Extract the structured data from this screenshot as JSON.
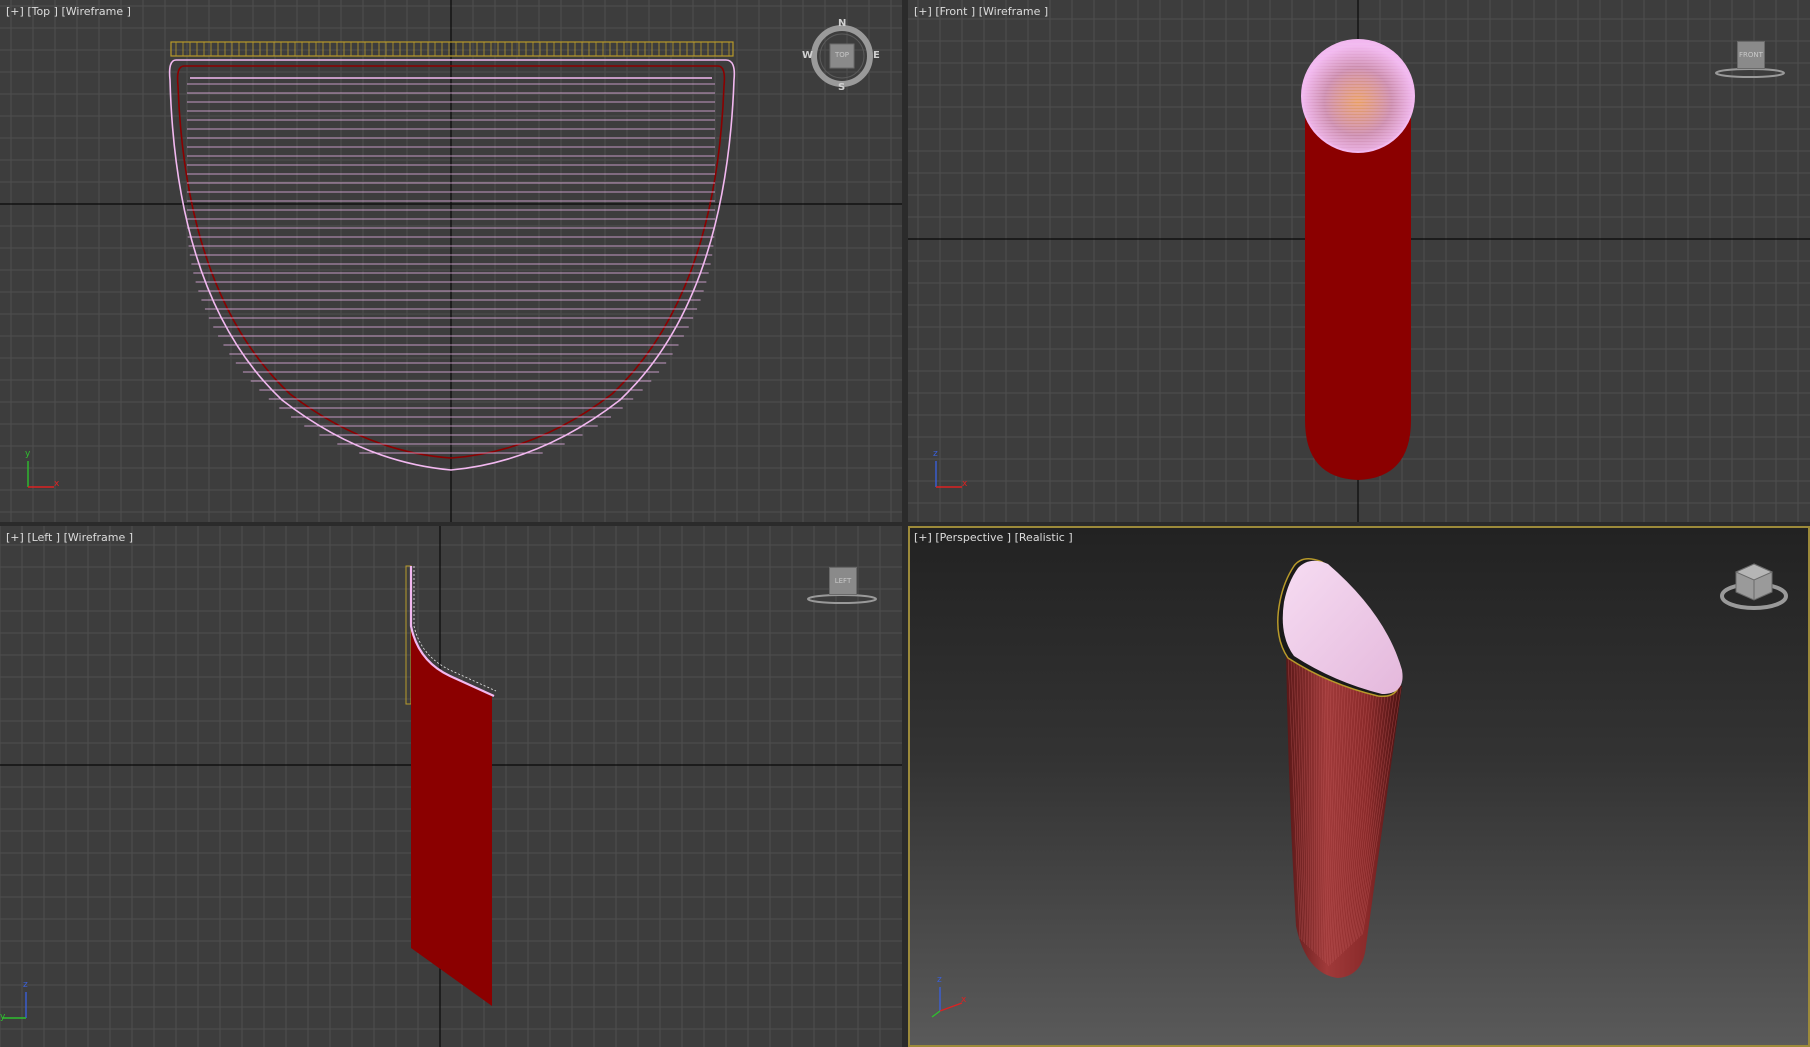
{
  "viewports": {
    "top": {
      "plus": "[+]",
      "view": "[Top ]",
      "shading": "[Wireframe ]",
      "compass": {
        "n": "N",
        "s": "S",
        "e": "E",
        "w": "W",
        "cube": "TOP"
      },
      "axis": {
        "a": "y",
        "b": "x"
      }
    },
    "front": {
      "plus": "[+]",
      "view": "[Front ]",
      "shading": "[Wireframe ]",
      "cube": "FRONT",
      "axis": {
        "a": "z",
        "b": "x"
      }
    },
    "left": {
      "plus": "[+]",
      "view": "[Left ]",
      "shading": "[Wireframe ]",
      "cube": "LEFT",
      "axis": {
        "a": "z",
        "b": "y"
      }
    },
    "perspective": {
      "plus": "[+]",
      "view": "[Perspective ]",
      "shading": "[Realistic ]",
      "axis": {
        "a": "z",
        "b": "x"
      }
    }
  },
  "colors": {
    "viewport_bg": "#3d3d3d",
    "grid": "#4f4f4f",
    "grid_main": "#0a0a0a",
    "object_red": "#8b0000",
    "wire_pink": "#f2b8f0",
    "selection_gold": "#b89a2a",
    "active_border": "#9c8a3a"
  }
}
